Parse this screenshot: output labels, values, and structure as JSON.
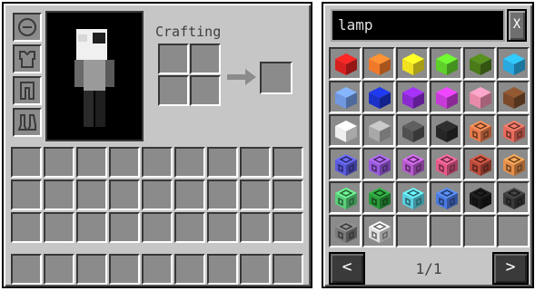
{
  "inventory": {
    "crafting_label": "Crafting",
    "armor_slots": [
      {
        "icon": "helmet-icon"
      },
      {
        "icon": "chestplate-icon"
      },
      {
        "icon": "leggings-icon"
      },
      {
        "icon": "boots-icon"
      }
    ]
  },
  "search": {
    "query": "lamp",
    "clear_label": "X"
  },
  "items": [
    {
      "kind": "cube",
      "color": "#d62020"
    },
    {
      "kind": "cube",
      "color": "#f07a2a"
    },
    {
      "kind": "cube",
      "color": "#f0e020"
    },
    {
      "kind": "cube",
      "color": "#5fd02a"
    },
    {
      "kind": "cube",
      "color": "#4a7a1a"
    },
    {
      "kind": "cube",
      "color": "#2aa8e0"
    },
    {
      "kind": "cube",
      "color": "#6f98e0"
    },
    {
      "kind": "cube",
      "color": "#1a30c8"
    },
    {
      "kind": "cube",
      "color": "#8a2ad0"
    },
    {
      "kind": "cube",
      "color": "#c83ad8"
    },
    {
      "kind": "cube",
      "color": "#e88aaa"
    },
    {
      "kind": "cube",
      "color": "#7a4a2a"
    },
    {
      "kind": "cube",
      "color": "#f0f0f0"
    },
    {
      "kind": "cube",
      "color": "#a8a8a8"
    },
    {
      "kind": "cube",
      "color": "#505050"
    },
    {
      "kind": "cube",
      "color": "#262626"
    },
    {
      "kind": "lamp",
      "color": "#e87a4a"
    },
    {
      "kind": "lamp",
      "color": "#e86a5a"
    },
    {
      "kind": "lamp",
      "color": "#5a5ae0"
    },
    {
      "kind": "lamp",
      "color": "#9a5ae0"
    },
    {
      "kind": "lamp",
      "color": "#b85ad0"
    },
    {
      "kind": "lamp",
      "color": "#e85a8a"
    },
    {
      "kind": "lamp",
      "color": "#b84a3a"
    },
    {
      "kind": "lamp",
      "color": "#e8904a"
    },
    {
      "kind": "lamp",
      "color": "#5ad07a"
    },
    {
      "kind": "lamp",
      "color": "#2a9a3a"
    },
    {
      "kind": "lamp",
      "color": "#5ad0e0"
    },
    {
      "kind": "lamp",
      "color": "#4a7ae0"
    },
    {
      "kind": "lamp",
      "color": "#1a1a1a"
    },
    {
      "kind": "lamp",
      "color": "#3a3a3a"
    },
    {
      "kind": "lamp",
      "color": "#7a7a7a"
    },
    {
      "kind": "lamp",
      "color": "#e0e0e0"
    },
    {
      "kind": "empty"
    },
    {
      "kind": "empty"
    },
    {
      "kind": "empty"
    },
    {
      "kind": "empty"
    }
  ],
  "pager": {
    "prev_label": "<",
    "next_label": ">",
    "page_text": "1/1"
  }
}
